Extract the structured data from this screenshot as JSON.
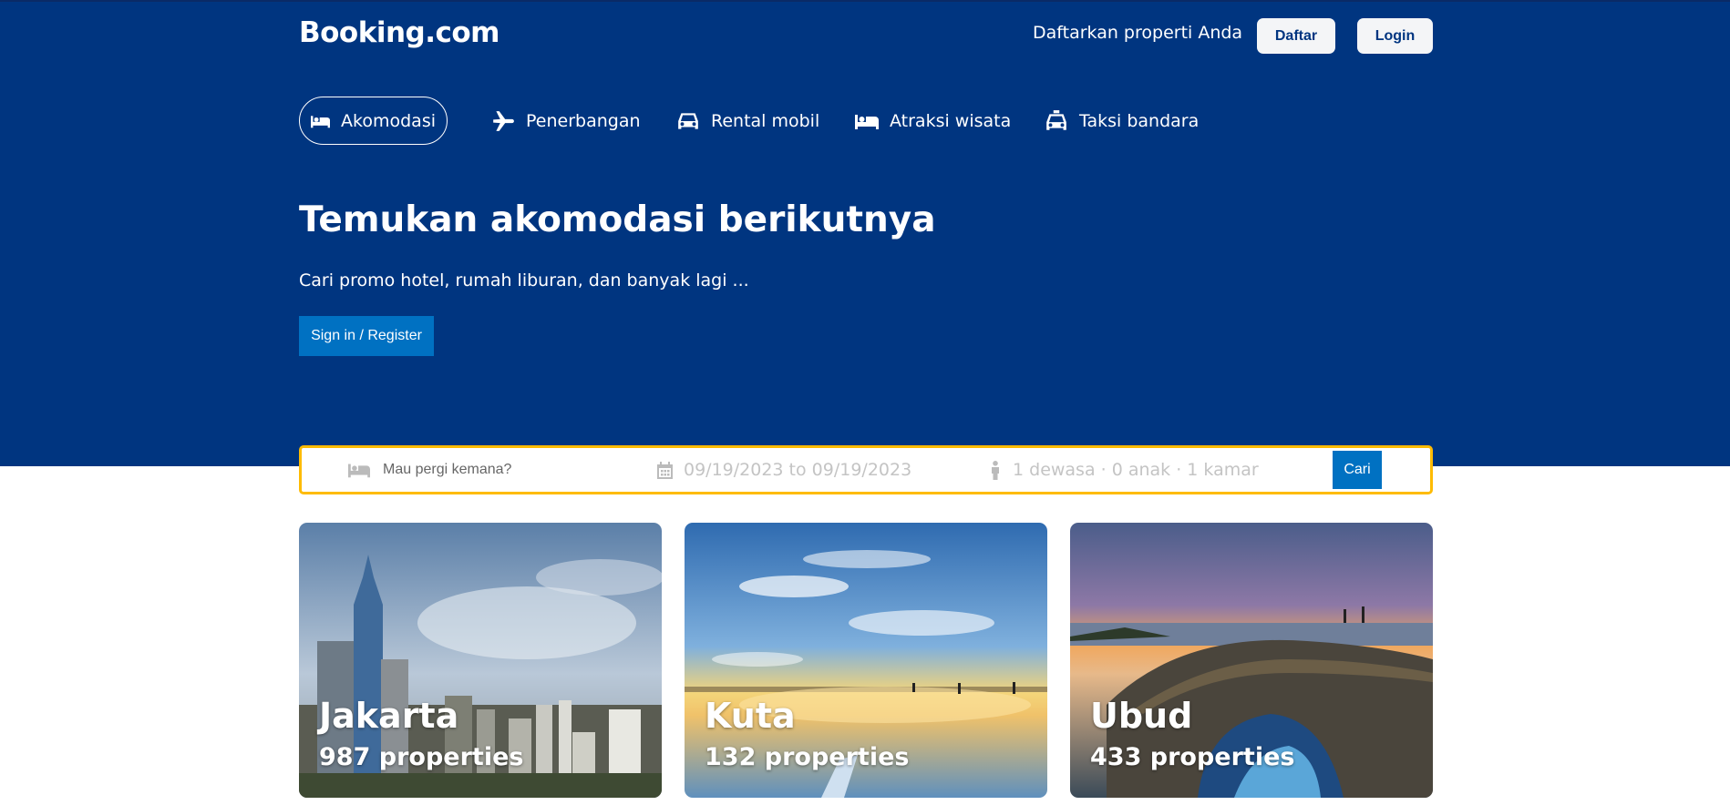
{
  "header": {
    "logo": "Booking.com",
    "register_property": "Daftarkan properti Anda",
    "daftar_label": "Daftar",
    "login_label": "Login"
  },
  "nav": {
    "items": [
      {
        "label": "Akomodasi",
        "icon": "bed-icon",
        "active": true
      },
      {
        "label": "Penerbangan",
        "icon": "airplane-icon",
        "active": false
      },
      {
        "label": "Rental mobil",
        "icon": "car-icon",
        "active": false
      },
      {
        "label": "Atraksi wisata",
        "icon": "bed-icon",
        "active": false
      },
      {
        "label": "Taksi bandara",
        "icon": "taxi-icon",
        "active": false
      }
    ]
  },
  "hero": {
    "title": "Temukan akomodasi berikutnya",
    "subtitle": "Cari promo hotel, rumah liburan, dan banyak lagi ...",
    "signin_label": "Sign in / Register"
  },
  "search": {
    "destination_placeholder": "Mau pergi kemana?",
    "dates": "09/19/2023 to 09/19/2023",
    "guests": "1 dewasa · 0 anak · 1 kamar",
    "button_label": "Cari"
  },
  "destinations": [
    {
      "name": "Jakarta",
      "count": "987 properties"
    },
    {
      "name": "Kuta",
      "count": "132 properties"
    },
    {
      "name": "Ubud",
      "count": "433 properties"
    }
  ],
  "colors": {
    "brand_blue": "#003580",
    "action_blue": "#0071c2",
    "search_border": "#febb02",
    "button_light": "#f4f5f7"
  }
}
